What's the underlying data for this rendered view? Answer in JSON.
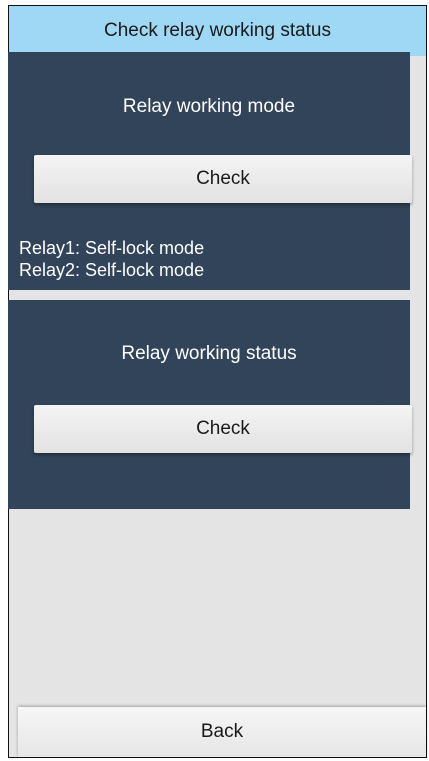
{
  "header": {
    "title": "Check relay working status"
  },
  "mode_section": {
    "title": "Relay working mode",
    "check_label": "Check",
    "results": [
      "Relay1: Self-lock mode",
      "Relay2: Self-lock mode"
    ]
  },
  "status_section": {
    "title": "Relay working status",
    "check_label": "Check"
  },
  "footer": {
    "back_label": "Back"
  },
  "colors": {
    "title_bar": "#9fd8f5",
    "panel": "#324459",
    "background": "#e4e4e4",
    "button": "#eeeeee"
  }
}
